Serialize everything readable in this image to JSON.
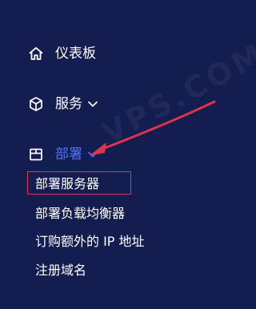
{
  "sidebar": {
    "dashboard": {
      "label": "仪表板",
      "icon": "home-icon"
    },
    "services": {
      "label": "服务",
      "icon": "cube-icon",
      "expand_icon": "chevron-down-icon"
    },
    "deploy": {
      "label": "部署",
      "icon": "box-icon",
      "expand_icon": "chevron-down-icon",
      "active_color": "#4b73ff",
      "children": [
        {
          "label": "部署服务器",
          "highlighted": true
        },
        {
          "label": "部署负载均衡器"
        },
        {
          "label": "订购额外的 IP 地址"
        },
        {
          "label": "注册域名"
        }
      ]
    }
  },
  "annotation": {
    "type": "red-arrow",
    "color": "#e1334a"
  },
  "watermark": {
    "text": "VPS.COM",
    "opacity": "faint"
  },
  "colors": {
    "background": "#131d4f",
    "text": "#ffffff",
    "active": "#4b73ff",
    "highlight": "#e1334a"
  }
}
